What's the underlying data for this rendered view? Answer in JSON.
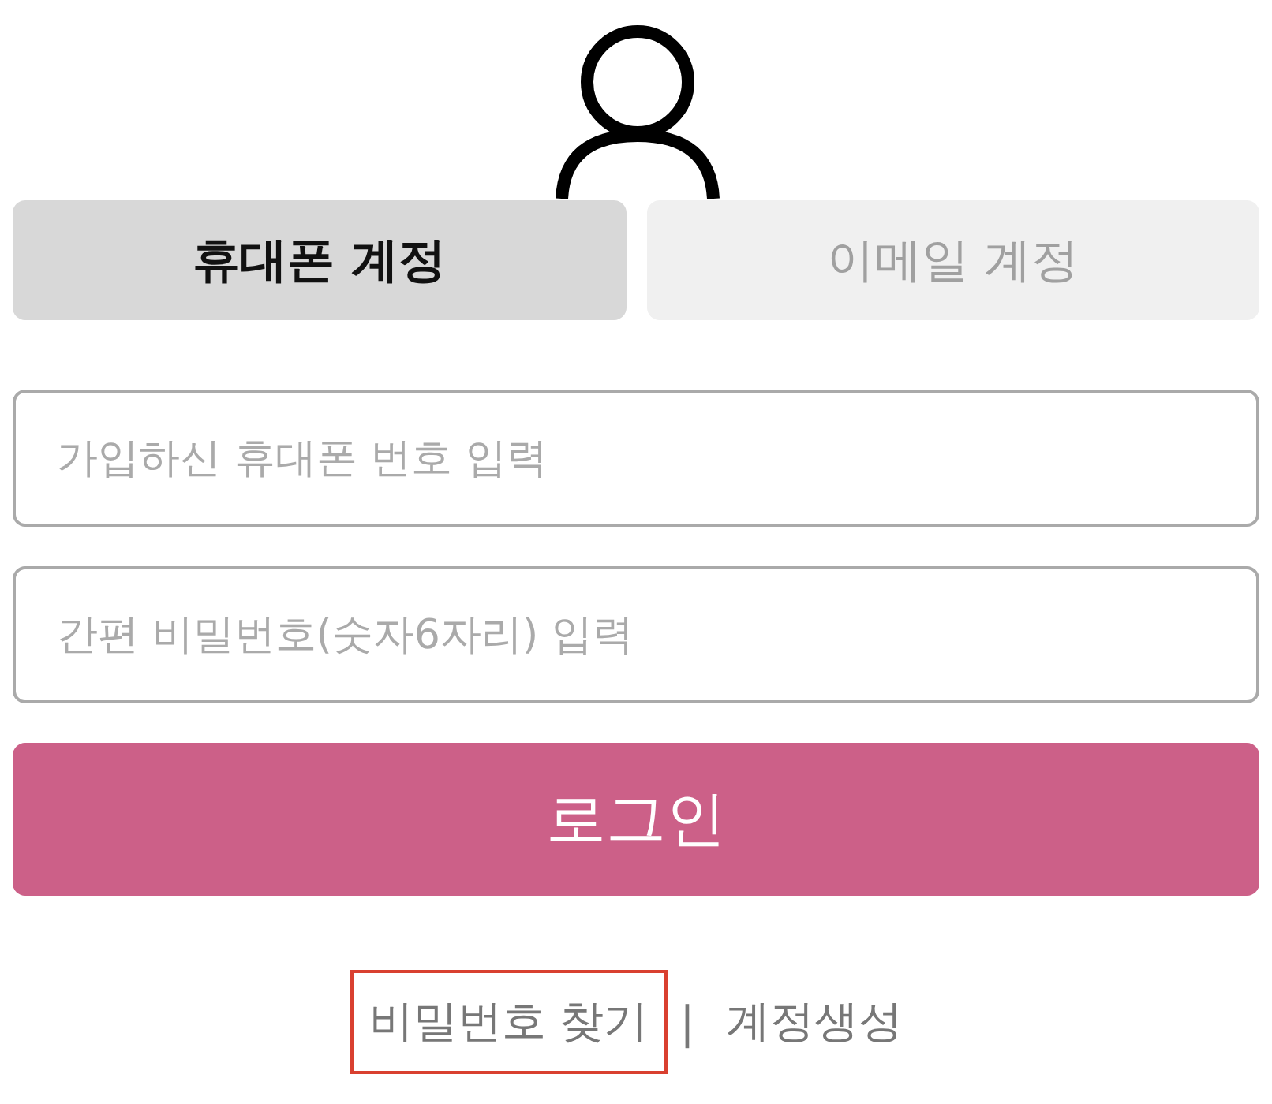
{
  "tabs": [
    {
      "label": "휴대폰 계정",
      "selected": true
    },
    {
      "label": "이메일 계정",
      "selected": false
    }
  ],
  "fields": [
    {
      "placeholder": "가입하신 휴대폰 번호 입력"
    },
    {
      "placeholder": "간편 비밀번호(숫자6자리) 입력"
    }
  ],
  "login_button": "로그인",
  "links": [
    {
      "label": "비밀번호 찾기",
      "highlighted": true
    },
    {
      "label": "계정생성",
      "highlighted": false
    }
  ],
  "separator": "|"
}
